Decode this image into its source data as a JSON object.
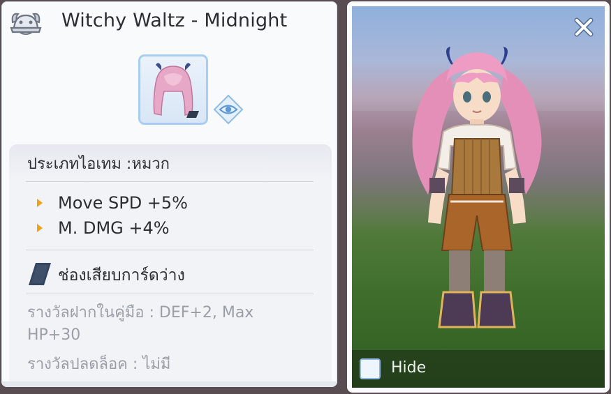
{
  "item": {
    "title": "Witchy Waltz - Midnight",
    "type_text": "ประเภทไอเทม :หมวก",
    "stats": [
      "Move SPD +5%",
      "M. DMG +4%"
    ],
    "slot_text": "ช่องเสียบการ์ดว่าง",
    "collection_reward": "รางวัลฝากในคู่มือ : DEF+2, Max HP+30",
    "unlock_reward": "รางวัลปลดล็อค : ไม่มี"
  },
  "icons": {
    "category": "helmet-icon",
    "view": "eye-icon",
    "card_slot": "card-slot-icon",
    "close": "close-icon"
  },
  "preview": {
    "hide_label": "Hide",
    "hide_checked": false
  },
  "colors": {
    "stat_arrow": "#f0a019",
    "slot_border": "#a9cdf0",
    "reward_text": "#9a9ea6"
  }
}
